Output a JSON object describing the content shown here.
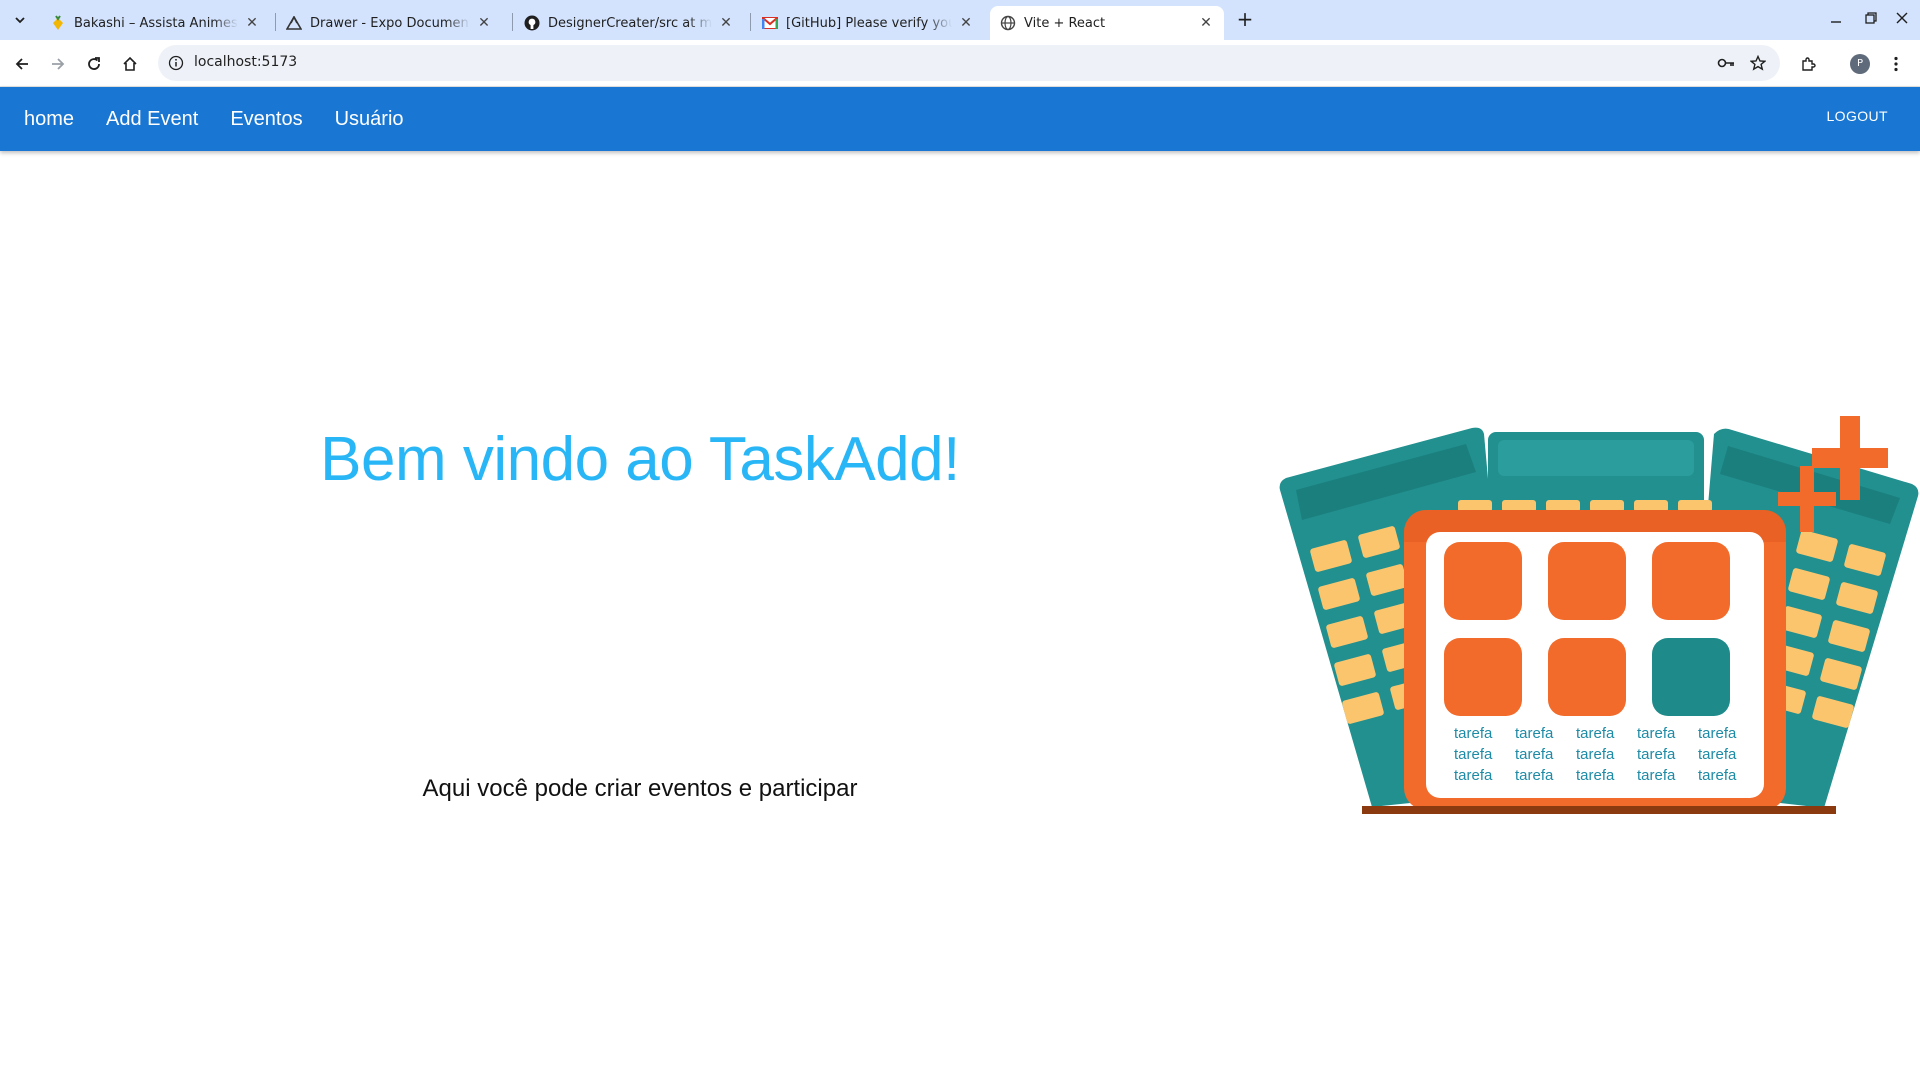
{
  "browser": {
    "tabs": [
      {
        "title": "Bakashi – Assista Animes Grátis"
      },
      {
        "title": "Drawer - Expo Documentation"
      },
      {
        "title": "DesignerCreater/src at master"
      },
      {
        "title": "[GitHub] Please verify your device"
      },
      {
        "title": "Vite + React"
      }
    ],
    "address": "localhost:5173",
    "profile_initial": "P"
  },
  "app": {
    "nav": {
      "home": "home",
      "add_event": "Add Event",
      "eventos": "Eventos",
      "usuario": "Usuário",
      "logout": "LOGOUT"
    },
    "hero": {
      "title": "Bem vindo ao TaskAdd!",
      "subtitle": "Aqui você pode criar eventos e participar"
    },
    "illustration": {
      "label": "tarefa"
    },
    "colors": {
      "appbar": "#1976d2",
      "title": "#29b6f6",
      "orange": "#f26b2a",
      "teal": "#1f8a8a"
    }
  }
}
